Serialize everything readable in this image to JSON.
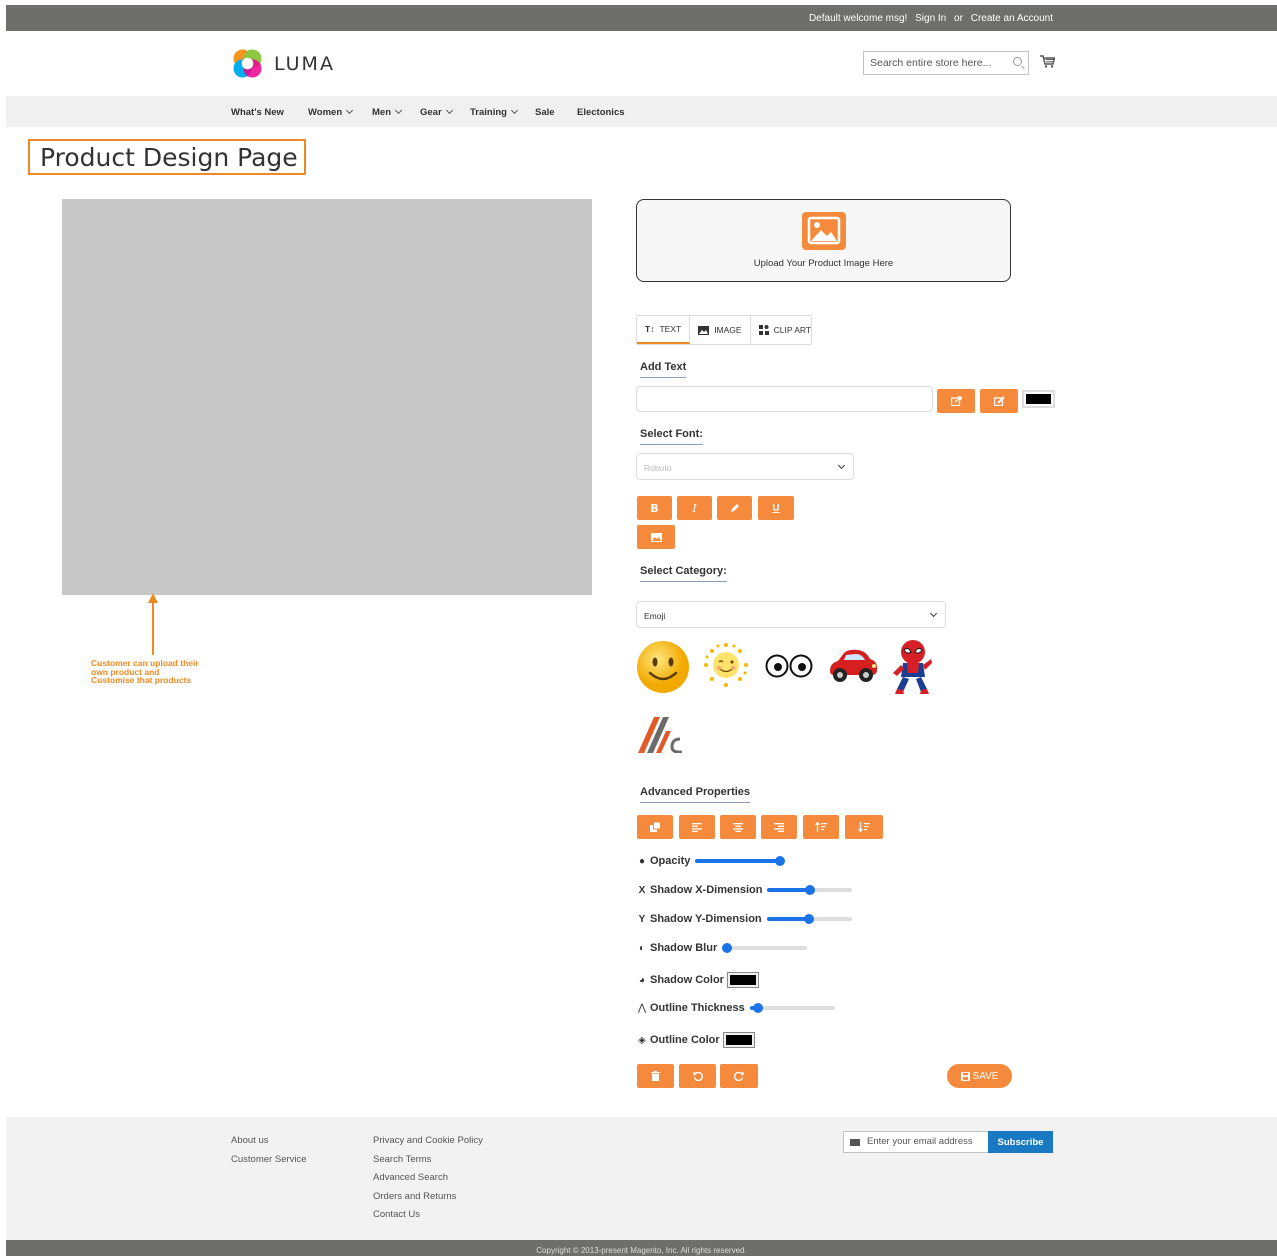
{
  "topbar": {
    "welcome": "Default welcome msg!",
    "sign_in": "Sign In",
    "or": "or",
    "create_account": "Create an Account"
  },
  "header": {
    "logo_text": "LUMA",
    "search_placeholder": "Search entire store here..."
  },
  "nav": {
    "items": [
      "What's New",
      "Women",
      "Men",
      "Gear",
      "Training",
      "Sale",
      "Electonics"
    ]
  },
  "page": {
    "title": "Product Design Page"
  },
  "annotation": {
    "line1": "Customer can upload their",
    "line2": "own product and",
    "line3": "Customise that products"
  },
  "upload": {
    "label": "Upload Your Product Image Here"
  },
  "tabs": [
    {
      "icon": "text-icon",
      "label": "TEXT"
    },
    {
      "icon": "image-icon",
      "label": "IMAGE"
    },
    {
      "icon": "clip-art-icon",
      "label": "CLIP ART"
    }
  ],
  "text_panel": {
    "add_text_label": "Add Text",
    "text_value": "",
    "color": "#000000"
  },
  "font": {
    "label": "Select Font:",
    "selected": "Roboto"
  },
  "category": {
    "label": "Select Category:",
    "selected": "Emoji"
  },
  "clipart": [
    "smiley-face",
    "winking-sun",
    "googly-eyes",
    "red-cartoon-car",
    "spider-man",
    "logo-mark"
  ],
  "advanced": {
    "label": "Advanced Properties",
    "opacity_label": "Opacity",
    "opacity_value": 1.0,
    "shadow_x_label": "Shadow X-Dimension",
    "shadow_x_value": 0.5,
    "shadow_y_label": "Shadow Y-Dimension",
    "shadow_y_value": 0.5,
    "shadow_blur_label": "Shadow Blur",
    "shadow_blur_value": 0.0,
    "shadow_color_label": "Shadow Color",
    "shadow_color": "#000000",
    "outline_thickness_label": "Outline Thickness",
    "outline_thickness_value": 0.1,
    "outline_color_label": "Outline Color",
    "outline_color": "#000000"
  },
  "actions": {
    "save_label": "SAVE"
  },
  "footer": {
    "col1": [
      "About us",
      "Customer Service"
    ],
    "col2": [
      "Privacy and Cookie Policy",
      "Search Terms",
      "Advanced Search",
      "Orders and Returns",
      "Contact Us"
    ],
    "newsletter_placeholder": "Enter your email address",
    "subscribe_label": "Subscribe",
    "copyright": "Copyright © 2013-present Magento, Inc. All rights reserved."
  },
  "colors": {
    "accent": "#f58a3c",
    "title_border": "#ec8a24",
    "slider": "#1a73e8",
    "subscribe": "#1979c3"
  }
}
